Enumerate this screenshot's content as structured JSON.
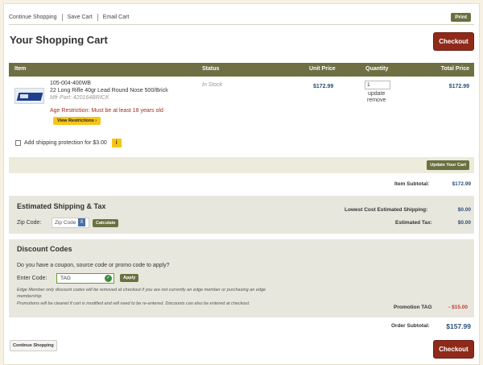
{
  "top_links": [
    "Continue Shopping",
    "Save Cart",
    "Email Cart"
  ],
  "print_label": "Print",
  "page_title": "Your Shopping Cart",
  "checkout_label": "Checkout",
  "table_headers": {
    "item": "Item",
    "status": "Status",
    "unit_price": "Unit Price",
    "quantity": "Quantity",
    "total_price": "Total Price"
  },
  "cart_item": {
    "sku": "105-004-400WB",
    "name": "22 Long Rifle 40gr Lead Round Nose 500/Brick",
    "mfr_part": "Mfr Part: 420164BRICK",
    "age_restriction": "Age Restriction: Must be at least 18 years old",
    "view_restrictions": "View Restrictions ›",
    "status": "In Stock",
    "unit_price": "$172.99",
    "quantity": "1",
    "update_link": "update",
    "remove_link": "remove",
    "total_price": "$172.99"
  },
  "shipping_protection": {
    "label": "Add shipping protection for $3.00",
    "info_icon": "i"
  },
  "update_cart_label": "Update Your Cart",
  "item_subtotal": {
    "label": "Item Subtotal:",
    "value": "$172.99"
  },
  "shipping": {
    "title": "Estimated Shipping & Tax",
    "zip_label": "Zip Code:",
    "zip_placeholder": "Zip Code",
    "clear_icon": "X",
    "calculate_label": "Calculate",
    "lowest_label": "Lowest Cost Estimated Shipping:",
    "lowest_value": "$0.00",
    "tax_label": "Estimated Tax:",
    "tax_value": "$0.00"
  },
  "discount": {
    "title": "Discount Codes",
    "question": "Do you have a coupon, source code or promo code to apply?",
    "code_label": "Enter Code:",
    "code_value": "TAG",
    "apply_label": "Apply",
    "note1": "Edge Member only discount codes will be removed at checkout if you are not currently an edge member or purchasing an edge membership.",
    "note2": "Promotions will be cleared if cart is modified and will need to be re-entered. Discounts can also be entered at checkout.",
    "promo_label": "Promotion TAG",
    "promo_value": "- $15.00"
  },
  "order_subtotal": {
    "label": "Order Subtotal:",
    "value": "$157.99"
  },
  "continue_shopping_label": "Continue Shopping",
  "colors": {
    "header_olive": "#6e7043",
    "checkout_red": "#8f2a1a",
    "price_blue": "#2b4f7a",
    "promo_red": "#c0392b",
    "badge_yellow": "#f5c518"
  }
}
